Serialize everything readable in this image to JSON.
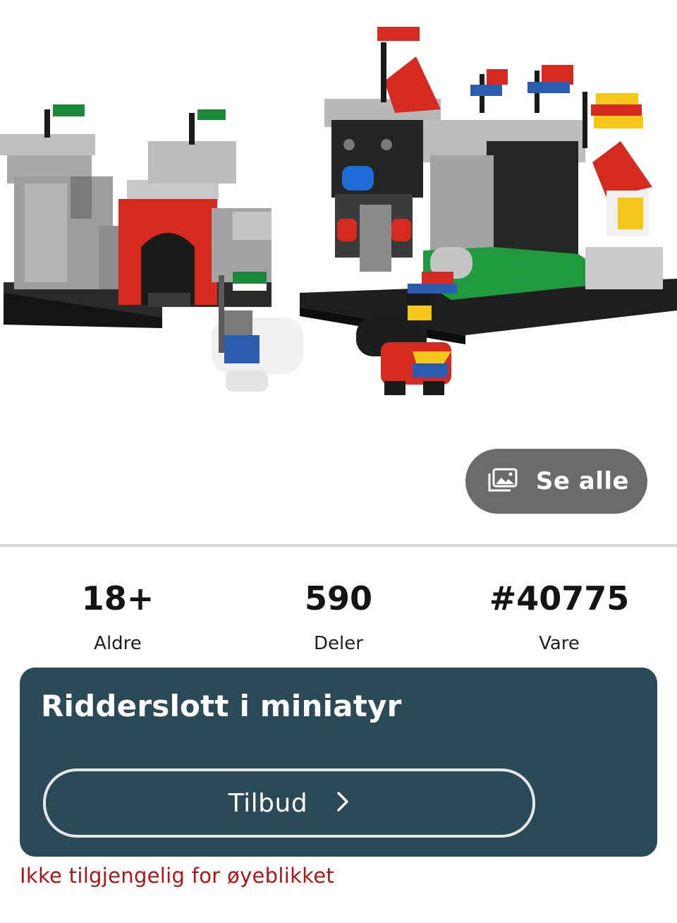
{
  "gallery": {
    "image_alt": "LEGO castle set with two castle sections and knight minifigures on horses",
    "see_all_label": "Se alle",
    "icon": "gallery-icon"
  },
  "stats": [
    {
      "value": "18+",
      "caption": "Aldre"
    },
    {
      "value": "590",
      "caption": "Deler"
    },
    {
      "value": "#40775",
      "caption": "Vare"
    }
  ],
  "product": {
    "title": "Ridderslott i miniatyr",
    "offer_label": "Tilbud",
    "offer_icon": "chevron-right-icon",
    "availability": "Ikke tilgjengelig for øyeblikket"
  },
  "colors": {
    "card_background": "#2b4a57",
    "button_gray": "#6b6b6b",
    "availability_red": "#b11414"
  }
}
